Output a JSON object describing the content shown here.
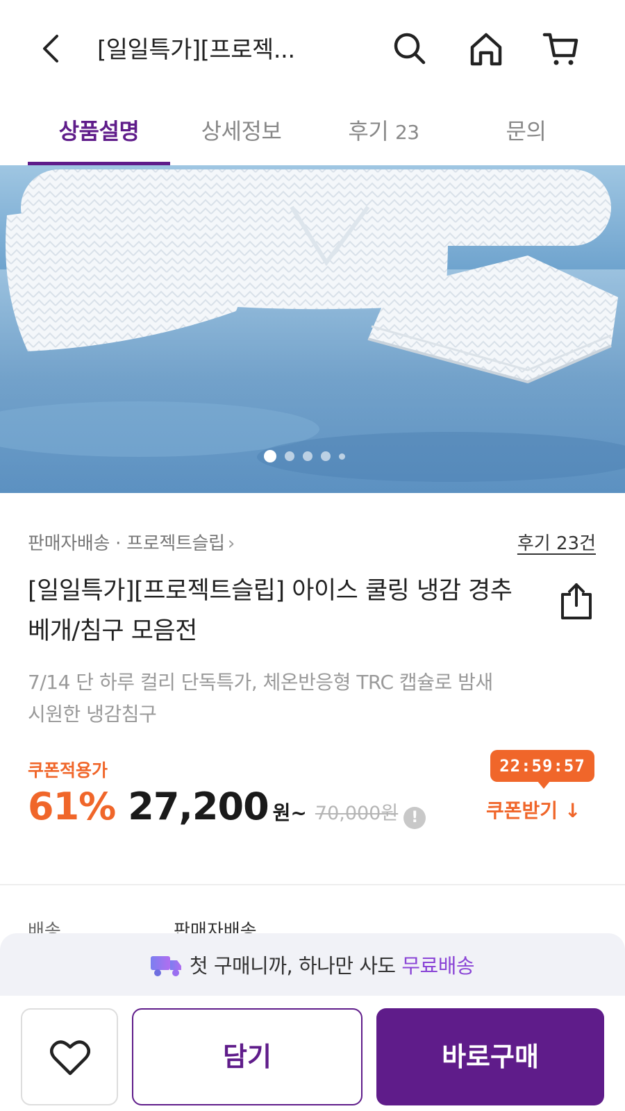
{
  "header": {
    "title": "[일일특가][프로젝...",
    "icons": [
      "back-arrow-icon",
      "search-icon",
      "home-icon",
      "cart-icon"
    ]
  },
  "tabs": [
    {
      "label": "상품설명",
      "count": "",
      "active": true
    },
    {
      "label": "상세정보",
      "count": "",
      "active": false
    },
    {
      "label": "후기",
      "count": "23",
      "active": false
    },
    {
      "label": "문의",
      "count": "",
      "active": false
    }
  ],
  "gallery": {
    "current": 1,
    "total": 5
  },
  "product": {
    "delivery_type": "판매자배송",
    "separator": "·",
    "brand": "프로젝트슬립",
    "reviews_link": "후기 23건",
    "title": "[일일특가][프로젝트슬립] 아이스 쿨링 냉감 경추베개/침구 모음전",
    "description": "7/14 단 하루 컬리 단독특가, 체온반응형 TRC 캡슐로 밤새 시원한 냉감침구"
  },
  "price": {
    "coupon_label": "쿠폰적용가",
    "discount": "61%",
    "value": "27,200",
    "unit": "원~",
    "original": "70,000원",
    "info_icon": "!"
  },
  "coupon": {
    "timer": "22:59:57",
    "button_label": "쿠폰받기",
    "download_icon": "↓"
  },
  "peek_row": {
    "label": "배송",
    "value": "판매자배송"
  },
  "promo": {
    "text": "첫 구매니까, 하나만 사도 ",
    "highlight": "무료배송"
  },
  "actions": {
    "cart_label": "담기",
    "buy_label": "바로구매"
  },
  "colors": {
    "brand_purple": "#5f1c8a",
    "accent_orange": "#f0662a",
    "free_shipping_purple": "#8a45d6"
  }
}
